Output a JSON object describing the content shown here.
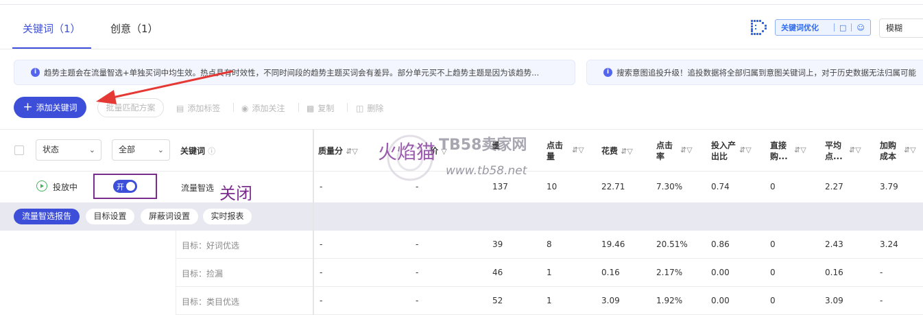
{
  "tabs": [
    {
      "label": "关键词（1）",
      "active": true
    },
    {
      "label": "创意（1）",
      "active": false
    }
  ],
  "right_tools": {
    "keyword_optimize": "关键词优化",
    "chat_icon": "chat-icon",
    "user_icon": "user-icon",
    "match_select": "模糊"
  },
  "banners": [
    "趋势主题会在流量智选+单独买词中均生效。热点具有时效性，不同时间段的趋势主题买词会有差异。部分单元买不上趋势主题是因为该趋势...",
    "搜索意图追投升级！追投数据将全部归属到意图关键词上，对于历史数据无法归属可能"
  ],
  "toolbar": {
    "add_keyword": "添加关键词",
    "batch_match": "批量匹配方案",
    "add_tag": "添加标签",
    "add_follow": "添加关注",
    "copy": "复制",
    "delete": "删除"
  },
  "filters": {
    "status_select": "状态",
    "scope_select": "全部"
  },
  "columns": {
    "keyword": "关键词",
    "quality": "质量分",
    "bid_partial": "价",
    "impressions_partial": "量",
    "clicks": "点击量",
    "cost": "花费",
    "ctr": "点击率",
    "roi": "投入产出比",
    "direct": "直接购...",
    "avg": "平均点...",
    "cart_cost": "加购成本"
  },
  "main_row": {
    "status": "投放中",
    "toggle_label": "开",
    "keyword": "流量智选",
    "quality": "-",
    "bid": "-",
    "impressions": "137",
    "clicks": "10",
    "cost": "22.71",
    "ctr": "7.30%",
    "roi": "0.74",
    "direct": "0",
    "avg": "2.27",
    "cart_cost": "3.79"
  },
  "annotation": {
    "close_label": "关闭",
    "arrow_color": "#e53935",
    "box_color": "#7a2c8c"
  },
  "report_tabs": [
    "流量智选报告",
    "目标设置",
    "屏蔽词设置",
    "实时报表"
  ],
  "sub_rows": [
    {
      "label": "目标：好词优选",
      "quality": "-",
      "bid": "-",
      "impressions": "39",
      "clicks": "8",
      "cost": "19.46",
      "ctr": "20.51%",
      "roi": "0.86",
      "direct": "0",
      "avg": "2.43",
      "cart_cost": "3.24"
    },
    {
      "label": "目标：捡漏",
      "quality": "-",
      "bid": "-",
      "impressions": "46",
      "clicks": "1",
      "cost": "0.16",
      "ctr": "2.17%",
      "roi": "0.00",
      "direct": "0",
      "avg": "0.16",
      "cart_cost": "-"
    },
    {
      "label": "目标：类目优选",
      "quality": "-",
      "bid": "-",
      "impressions": "52",
      "clicks": "1",
      "cost": "3.09",
      "ctr": "1.92%",
      "roi": "0.00",
      "direct": "0",
      "avg": "3.09",
      "cart_cost": "-"
    }
  ],
  "watermark": {
    "site_name": "TB58卖家网",
    "site_url": "www.tb58.net",
    "brand": "火焰猫"
  },
  "colors": {
    "accent": "#3d4fd8",
    "status_green": "#46b15b"
  }
}
